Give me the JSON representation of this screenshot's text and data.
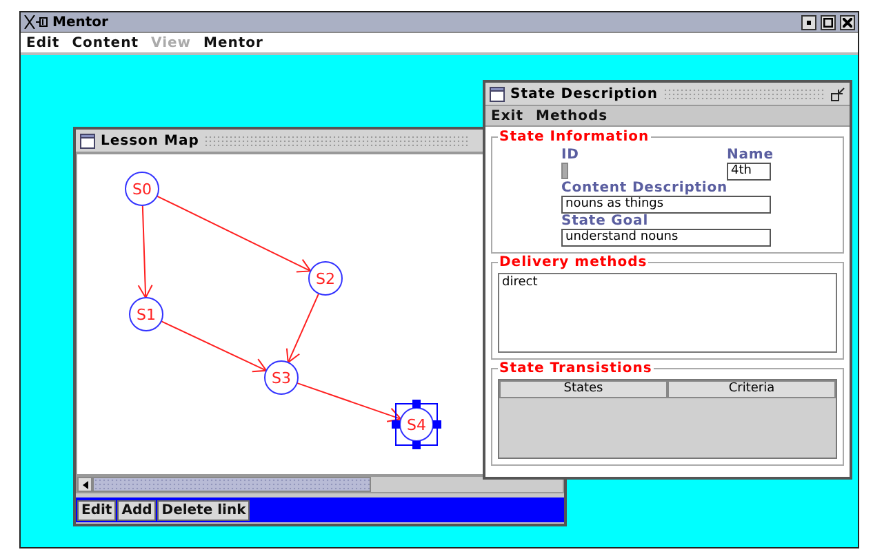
{
  "app": {
    "title": "Mentor",
    "menu": [
      {
        "label": "Edit",
        "disabled": false
      },
      {
        "label": "Content",
        "disabled": false
      },
      {
        "label": "View",
        "disabled": true
      },
      {
        "label": "Mentor",
        "disabled": false
      }
    ]
  },
  "lesson_map": {
    "title": "Lesson Map",
    "nodes": [
      {
        "label": "S0",
        "selected": false
      },
      {
        "label": "S1",
        "selected": false
      },
      {
        "label": "S2",
        "selected": false
      },
      {
        "label": "S3",
        "selected": false
      },
      {
        "label": "S4",
        "selected": true
      }
    ],
    "buttons": [
      "Edit",
      "Add",
      "Delete link"
    ]
  },
  "state_description": {
    "title": "State Description",
    "menu": [
      "Exit",
      "Methods"
    ],
    "state_information": {
      "title": "State Information",
      "id_label": "ID",
      "name_label": "Name",
      "name_value": "4th",
      "content_label": "Content Description",
      "content_value": "nouns as things",
      "goal_label": "State Goal",
      "goal_value": "understand nouns"
    },
    "delivery": {
      "title": "Delivery methods",
      "value": "direct"
    },
    "transitions": {
      "title": "State Transistions",
      "columns": [
        "States",
        "Criteria"
      ]
    }
  }
}
